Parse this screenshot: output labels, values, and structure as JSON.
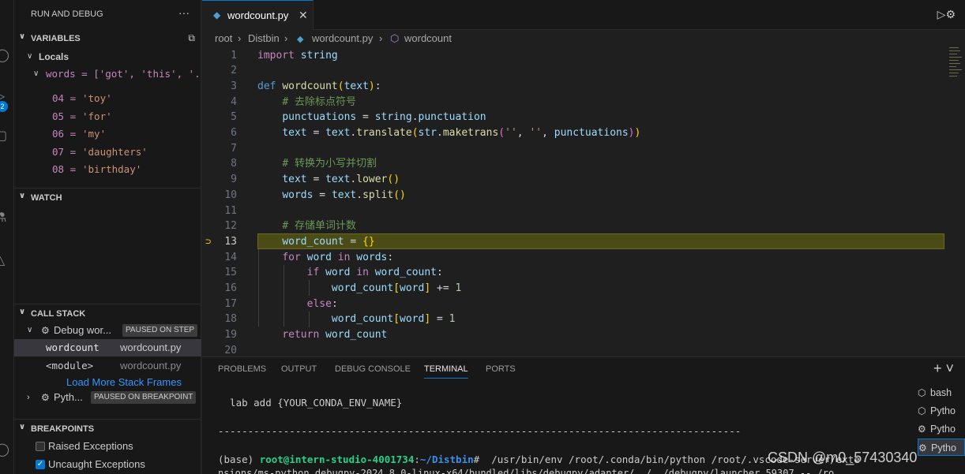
{
  "sidebar": {
    "title": "RUN AND DEBUG",
    "more": "···",
    "variables": {
      "label": "VARIABLES",
      "locals_label": "Locals",
      "words_row": "words = ['got', 'this', '...",
      "items": [
        {
          "index": "04",
          "value": "'toy'"
        },
        {
          "index": "05",
          "value": "'for'"
        },
        {
          "index": "06",
          "value": "'my'"
        },
        {
          "index": "07",
          "value": "'daughters'"
        },
        {
          "index": "08",
          "value": "'birthday'"
        }
      ]
    },
    "watch": {
      "label": "WATCH"
    },
    "callstack": {
      "label": "CALL STACK",
      "thread1_name": "Debug wor...",
      "thread1_status": "PAUSED ON STEP",
      "frames": [
        {
          "name": "wordcount",
          "file": "wordcount.py"
        },
        {
          "name": "<module>",
          "file": "wordcount.py"
        }
      ],
      "load_more": "Load More Stack Frames",
      "thread2_name": "Pyth...",
      "thread2_status": "PAUSED ON BREAKPOINT"
    },
    "breakpoints": {
      "label": "BREAKPOINTS",
      "items": [
        {
          "label": "Raised Exceptions",
          "checked": false
        },
        {
          "label": "Uncaught Exceptions",
          "checked": true
        }
      ]
    }
  },
  "editor": {
    "tab_label": "wordcount.py",
    "breadcrumb": {
      "root": "root",
      "folder": "Distbin",
      "file": "wordcount.py",
      "symbol": "wordcount"
    },
    "current_line": 13
  },
  "panel": {
    "tabs": [
      "PROBLEMS",
      "OUTPUT",
      "DEBUG CONSOLE",
      "TERMINAL",
      "PORTS"
    ],
    "active_tab": "TERMINAL",
    "terminal": {
      "line1": "  lab add {YOUR_CONDA_ENV_NAME}",
      "line2": "----------------------------------------------------------------------------------------",
      "prompt_prefix": "(base) ",
      "prompt_user": "root@intern-studio-4001734",
      "prompt_sep": ":",
      "prompt_path": "~/Distbin",
      "prompt_cmd": "#  /usr/bin/env /root/.conda/bin/python /root/.vscode-server/exte",
      "line4": "nsions/ms-python.debugpy-2024.8.0-linux-x64/bundled/libs/debugpy/adapter/../../debugpy/launcher 59307 -- /ro"
    },
    "terminal_list": [
      {
        "label": "bash",
        "icon": "terminal-icon"
      },
      {
        "label": "Pytho",
        "icon": "terminal-icon"
      },
      {
        "label": "Pytho",
        "icon": "debug-gear-icon"
      },
      {
        "label": "Pytho",
        "icon": "debug-gear-icon"
      }
    ]
  },
  "watermark": "CSDN @m0_57430340"
}
